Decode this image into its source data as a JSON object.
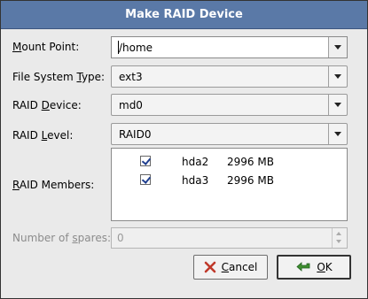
{
  "window": {
    "title": "Make RAID Device"
  },
  "form": {
    "mount_point": {
      "label_pre": "",
      "label_u": "M",
      "label_post": "ount Point:",
      "value": "/home"
    },
    "fs_type": {
      "label_pre": "File System ",
      "label_u": "T",
      "label_post": "ype:",
      "value": "ext3"
    },
    "raid_device": {
      "label_pre": "RAID ",
      "label_u": "D",
      "label_post": "evice:",
      "value": "md0"
    },
    "raid_level": {
      "label_pre": "RAID ",
      "label_u": "L",
      "label_post": "evel:",
      "value": "RAID0"
    },
    "raid_members": {
      "label_pre": "",
      "label_u": "R",
      "label_post": "AID Members:",
      "items": [
        {
          "device": "hda2",
          "size": "2996 MB",
          "checked": true
        },
        {
          "device": "hda3",
          "size": "2996 MB",
          "checked": true
        }
      ]
    },
    "spares": {
      "label_pre": "Number of ",
      "label_u": "s",
      "label_post": "pares:",
      "value": "0"
    }
  },
  "buttons": {
    "cancel": {
      "pre": "",
      "u": "C",
      "post": "ancel"
    },
    "ok": {
      "pre": "",
      "u": "O",
      "post": "K"
    }
  },
  "colors": {
    "titlebar": "#5a79a7",
    "dialog_bg": "#eaeaea",
    "ok_icon": "#3f8f2f",
    "cancel_icon": "#c0392b"
  }
}
